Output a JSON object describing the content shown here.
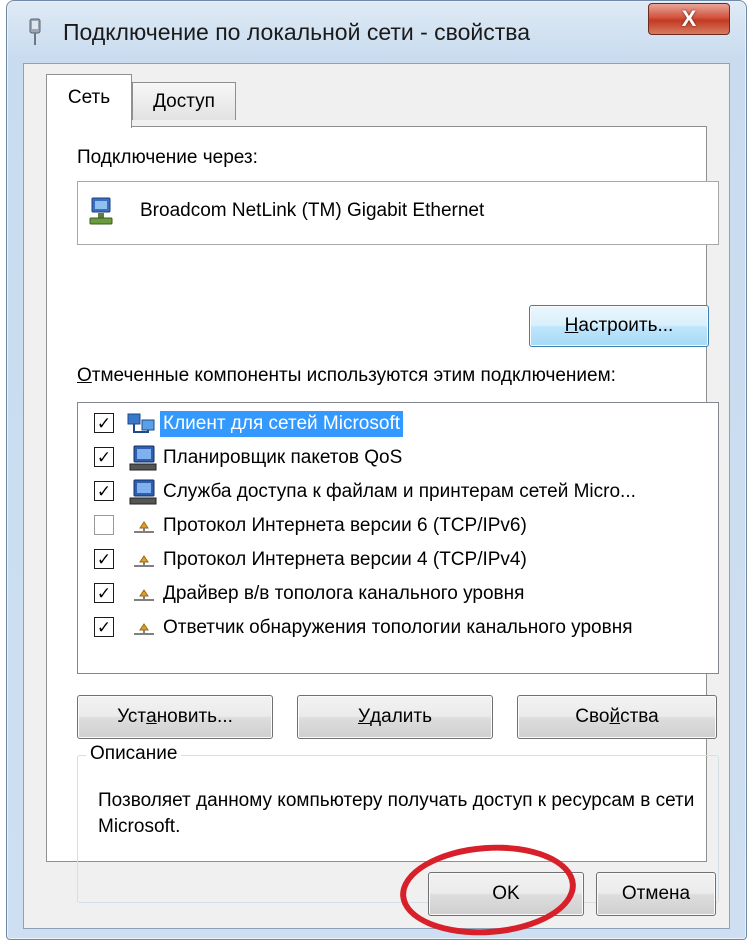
{
  "window": {
    "title": "Подключение по локальной сети - свойства",
    "close_label": "X"
  },
  "tabs": [
    {
      "label": "Сеть",
      "active": true
    },
    {
      "label": "Доступ",
      "active": false
    }
  ],
  "network_tab": {
    "connect_via_label": "Подключение через:",
    "adapter_name": "Broadcom NetLink (TM) Gigabit Ethernet",
    "configure_button": {
      "accel": "Н",
      "rest": "астроить..."
    },
    "components_label": {
      "accel": "О",
      "rest": "тмеченные компоненты используются этим подключением:"
    },
    "components": [
      {
        "checked": true,
        "icon": "network-client-icon",
        "label": "Клиент для сетей Microsoft",
        "selected": true
      },
      {
        "checked": true,
        "icon": "computer-icon",
        "label": "Планировщик пакетов QoS",
        "selected": false
      },
      {
        "checked": true,
        "icon": "computer-icon",
        "label": "Служба доступа к файлам и принтерам сетей Micro...",
        "selected": false
      },
      {
        "checked": false,
        "icon": "protocol-icon",
        "label": "Протокол Интернета версии 6 (TCP/IPv6)",
        "selected": false
      },
      {
        "checked": true,
        "icon": "protocol-icon",
        "label": "Протокол Интернета версии 4 (TCP/IPv4)",
        "selected": false
      },
      {
        "checked": true,
        "icon": "protocol-icon",
        "label": "Драйвер в/в тополога канального уровня",
        "selected": false
      },
      {
        "checked": true,
        "icon": "protocol-icon",
        "label": "Ответчик обнаружения топологии канального уровня",
        "selected": false
      }
    ],
    "install_button": {
      "pre": "Уст",
      "accel": "а",
      "rest": "новить..."
    },
    "remove_button": {
      "pre": "",
      "accel": "У",
      "rest": "далить"
    },
    "properties_button": {
      "pre": "Сво",
      "accel": "й",
      "rest": "ства"
    },
    "description_group_title": "Описание",
    "description_text": "Позволяет данному компьютеру получать доступ к ресурсам в сети Microsoft."
  },
  "footer": {
    "ok_label": "OK",
    "cancel_label": "Отмена"
  },
  "colors": {
    "selection": "#3399ff",
    "annotation_circle": "#d8202a"
  }
}
